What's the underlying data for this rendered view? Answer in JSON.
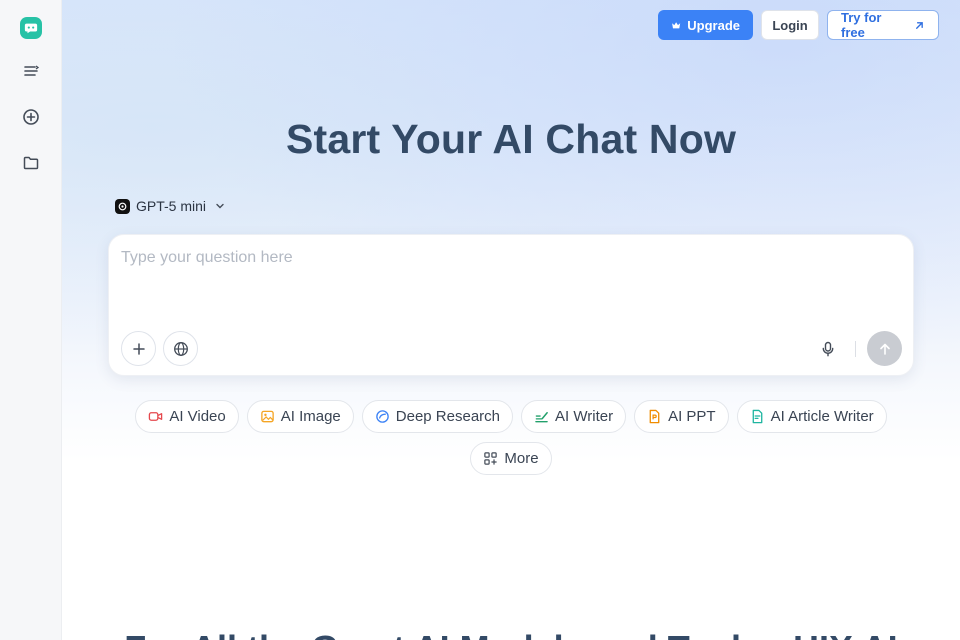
{
  "header": {
    "upgrade_label": "Upgrade",
    "login_label": "Login",
    "try_label": "Try for free"
  },
  "hero": {
    "title": "Start Your AI Chat Now"
  },
  "model": {
    "selected": "GPT-5 mini"
  },
  "chat": {
    "placeholder": "Type your question here"
  },
  "tools": [
    {
      "label": "AI Video",
      "icon": "video-icon",
      "color": "#e5484d"
    },
    {
      "label": "AI Image",
      "icon": "image-icon",
      "color": "#f5a524"
    },
    {
      "label": "Deep Research",
      "icon": "research-icon",
      "color": "#3b82f6"
    },
    {
      "label": "AI Writer",
      "icon": "writer-icon",
      "color": "#22a06b"
    },
    {
      "label": "AI PPT",
      "icon": "ppt-icon",
      "color": "#f08c00"
    },
    {
      "label": "AI Article Writer",
      "icon": "article-icon",
      "color": "#1fb5a0"
    },
    {
      "label": "More",
      "icon": "grid-icon",
      "color": "#444c58"
    }
  ],
  "section": {
    "heading": "For All the Great AI Models and Tools · HIX AI"
  },
  "colors": {
    "accent": "#3b82f6",
    "brand": "#27c2a6",
    "title": "#334a66"
  }
}
